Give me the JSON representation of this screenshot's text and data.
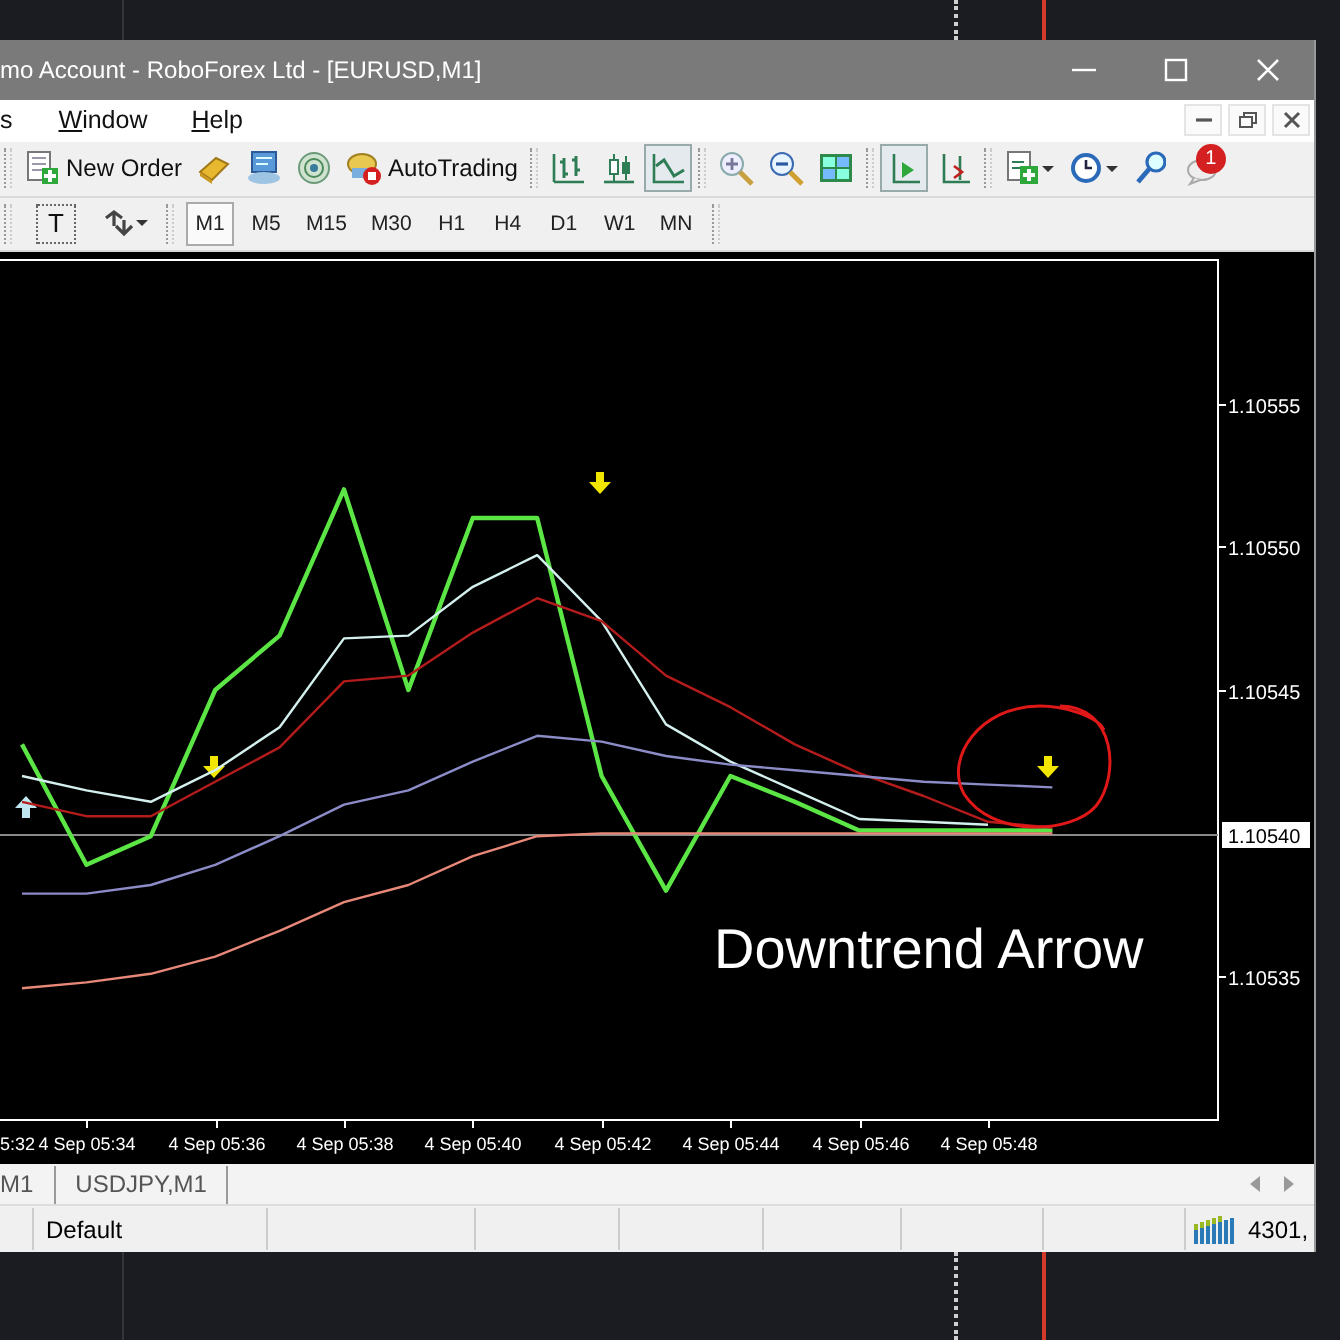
{
  "window": {
    "title": "mo Account - RoboForex Ltd - [EURUSD,M1]"
  },
  "menu": [
    {
      "label": "s"
    },
    {
      "label": "Window"
    },
    {
      "label": "Help"
    }
  ],
  "toolbar": {
    "new_order": "New Order",
    "auto_trading": "AutoTrading",
    "line_chart_pressed": true,
    "chart_shift_pressed": true,
    "notification_count": "1"
  },
  "tools": {
    "text_tool": "T"
  },
  "timeframes": [
    {
      "label": "M1",
      "selected": true
    },
    {
      "label": "M5",
      "selected": false
    },
    {
      "label": "M15",
      "selected": false
    },
    {
      "label": "M30",
      "selected": false
    },
    {
      "label": "H1",
      "selected": false
    },
    {
      "label": "H4",
      "selected": false
    },
    {
      "label": "D1",
      "selected": false
    },
    {
      "label": "W1",
      "selected": false
    },
    {
      "label": "MN",
      "selected": false
    }
  ],
  "chart": {
    "chart_data": {
      "type": "line",
      "categories": [
        null,
        "4 Sep 05:34",
        null,
        "4 Sep 05:36",
        null,
        "4 Sep 05:38",
        null,
        "4 Sep 05:40",
        null,
        "4 Sep 05:42",
        null,
        "4 Sep 05:44",
        null,
        "4 Sep 05:46",
        null,
        "4 Sep 05:48",
        null
      ],
      "series": [
        {
          "color": "#5ce646",
          "values": [
            1.105431,
            1.105389,
            1.105399,
            1.10545,
            1.105469,
            1.10552,
            1.10545,
            1.10551,
            1.10551,
            1.10542,
            1.10538,
            1.10542,
            1.105411,
            1.105401,
            1.105401,
            1.105401,
            1.105401
          ]
        },
        {
          "color": "#d4f0ee",
          "values": [
            1.10542,
            1.105415,
            1.105411,
            1.105422,
            1.105437,
            1.105468,
            1.105469,
            1.105486,
            1.105497,
            1.105474,
            1.105438,
            1.105425,
            1.105415,
            1.105405,
            1.105404,
            1.105403,
            null
          ]
        },
        {
          "color": "#b41c1c",
          "values": [
            1.105411,
            1.105406,
            1.105406,
            1.105418,
            1.10543,
            1.105453,
            1.105455,
            1.10547,
            1.105482,
            1.105474,
            1.105455,
            1.105444,
            1.105431,
            1.105421,
            1.105413,
            1.105404,
            1.105402
          ]
        },
        {
          "color": "#8c8cc8",
          "values": [
            1.105379,
            1.105379,
            1.105382,
            1.105389,
            1.105399,
            1.10541,
            1.105415,
            1.105425,
            1.105434,
            1.105432,
            1.105427,
            1.105424,
            1.105422,
            1.10542,
            1.105418,
            1.105417,
            1.105416
          ]
        },
        {
          "color": "#e88878",
          "values": [
            1.105346,
            1.105348,
            1.105351,
            1.105357,
            1.105366,
            1.105376,
            1.105382,
            1.105392,
            1.105399,
            1.1054,
            1.1054,
            1.1054,
            1.1054,
            1.1054,
            1.1054,
            1.1054,
            1.1054
          ]
        }
      ],
      "ylim": [
        1.1053,
        1.1056
      ],
      "yticks": [
        {
          "value": 1.10535,
          "label": "1.10535"
        },
        {
          "value": 1.10545,
          "label": "1.10545"
        },
        {
          "value": 1.1055,
          "label": "1.10550"
        },
        {
          "value": 1.10555,
          "label": "1.10555"
        }
      ],
      "ref_lines": [
        {
          "value": 1.1054,
          "axis": "y",
          "label": "1.10540"
        }
      ],
      "annotations": [
        "Downtrend Arrow"
      ]
    },
    "edge_time_label": "5:32",
    "markers": [
      {
        "kind": "arrow_up",
        "color": "#bfe6f0"
      },
      {
        "kind": "arrow_down",
        "color": "#f2e600"
      },
      {
        "kind": "arrow_down",
        "color": "#f2e600"
      },
      {
        "kind": "arrow_down",
        "color": "#f2e600"
      },
      {
        "kind": "circle",
        "color": "#e01818"
      }
    ]
  },
  "chart_tabs": [
    {
      "label": "M1",
      "selected": false
    },
    {
      "label": "USDJPY,M1",
      "selected": false
    }
  ],
  "status_bar": {
    "profile": "Default",
    "connection": "4301,"
  }
}
